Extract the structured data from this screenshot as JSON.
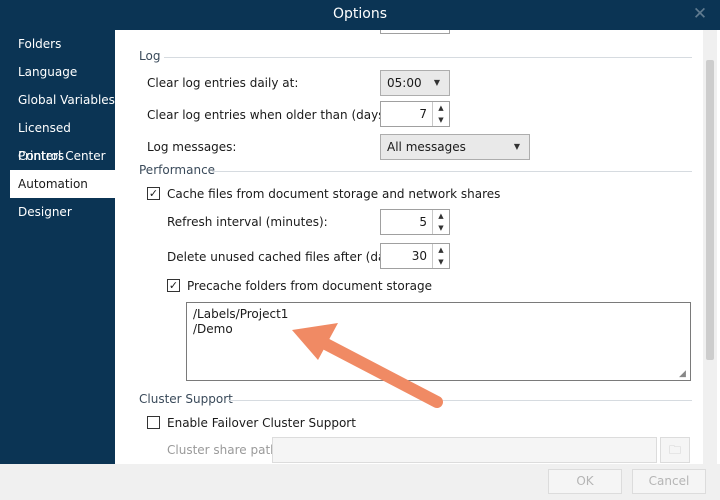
{
  "window": {
    "title": "Options",
    "close_glyph": "✕"
  },
  "sidebar": {
    "items": [
      {
        "label": "Folders"
      },
      {
        "label": "Language"
      },
      {
        "label": "Global Variables"
      },
      {
        "label": "Licensed Printers"
      },
      {
        "label": "Control Center"
      },
      {
        "label": "Automation",
        "active": true
      },
      {
        "label": "Designer"
      }
    ]
  },
  "log": {
    "section_title": "Log",
    "clear_daily_label": "Clear log entries daily at:",
    "clear_daily_value": "05:00",
    "clear_older_label": "Clear log entries when older than (days):",
    "clear_older_value": "7",
    "messages_label": "Log messages:",
    "messages_value": "All messages"
  },
  "performance": {
    "section_title": "Performance",
    "cache_label": "Cache files from document storage and network shares",
    "cache_checked": true,
    "refresh_label": "Refresh interval (minutes):",
    "refresh_value": "5",
    "delete_label": "Delete unused cached files after (days):",
    "delete_value": "30",
    "precache_label": "Precache folders from document storage",
    "precache_checked": true,
    "folders": [
      "/Labels/Project1",
      "/Demo"
    ]
  },
  "cluster": {
    "section_title": "Cluster Support",
    "enable_label": "Enable Failover Cluster Support",
    "enable_checked": false,
    "share_path_label": "Cluster share path:",
    "share_path_value": ""
  },
  "footer": {
    "ok_label": "OK",
    "cancel_label": "Cancel"
  },
  "icons": {
    "checkmark": "✓",
    "dropdown": "▼",
    "spin_up": "▲",
    "spin_down": "▼",
    "folder": "🗀",
    "resize_grip": "◢"
  },
  "colors": {
    "sidebar_bg": "#0b3454",
    "annotation_arrow": "#f08a64"
  }
}
